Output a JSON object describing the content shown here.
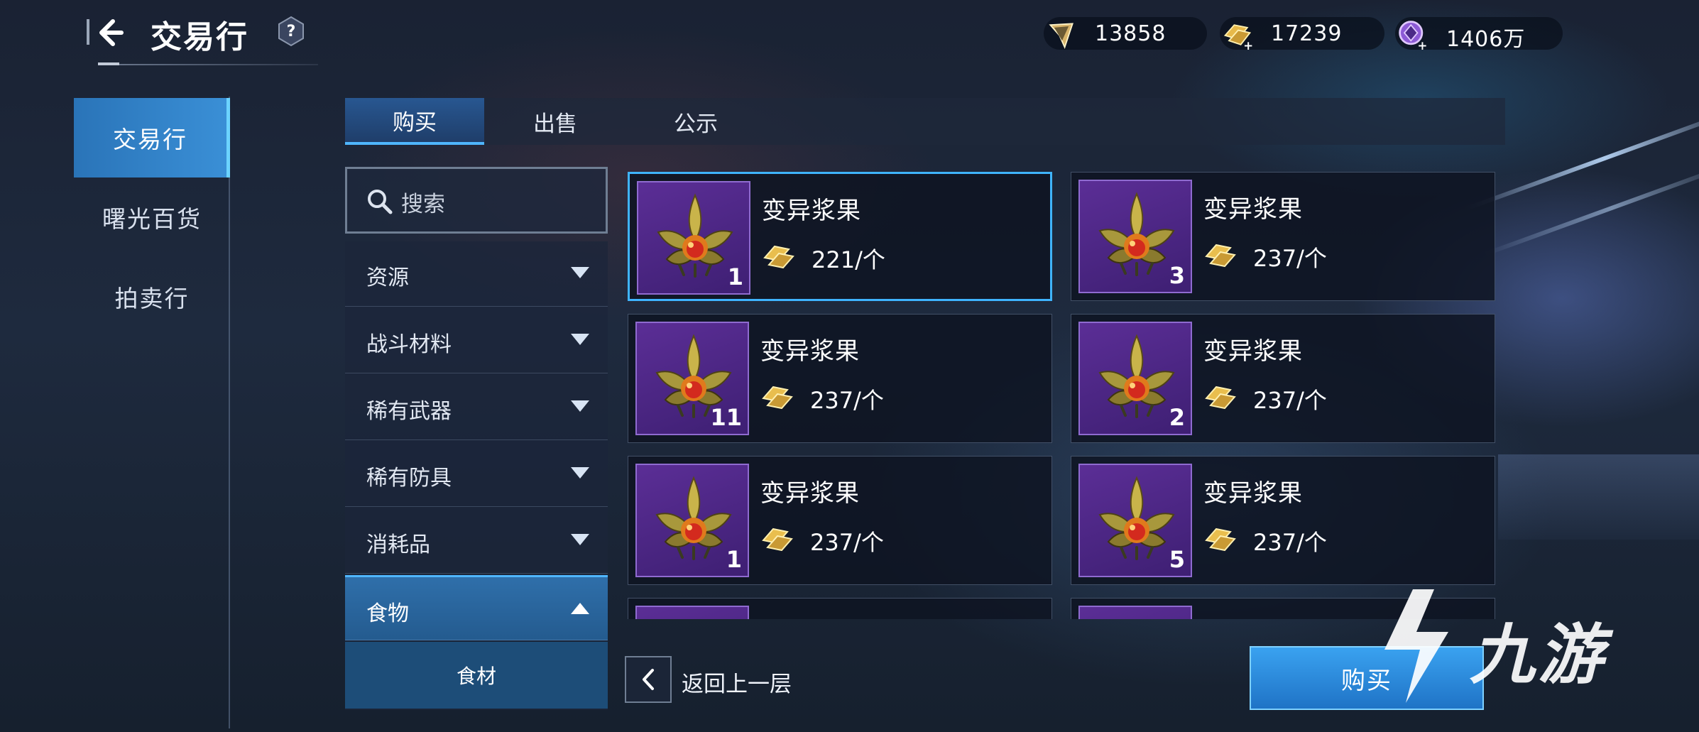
{
  "header": {
    "title": "交易行",
    "help_label": "?",
    "currencies": [
      {
        "icon": "crystal-shard-icon",
        "value": "13858"
      },
      {
        "icon": "gold-bar-plus-icon",
        "value": "17239"
      },
      {
        "icon": "purple-coin-plus-icon",
        "value": "1406万"
      }
    ]
  },
  "sidebar": {
    "items": [
      {
        "label": "交易行",
        "active": true
      },
      {
        "label": "曙光百货",
        "active": false
      },
      {
        "label": "拍卖行",
        "active": false
      }
    ]
  },
  "tabs": [
    {
      "label": "购买",
      "active": true
    },
    {
      "label": "出售",
      "active": false
    },
    {
      "label": "公示",
      "active": false
    }
  ],
  "search": {
    "placeholder": "搜索"
  },
  "categories": [
    {
      "label": "资源",
      "expanded": false
    },
    {
      "label": "战斗材料",
      "expanded": false
    },
    {
      "label": "稀有武器",
      "expanded": false
    },
    {
      "label": "稀有防具",
      "expanded": false
    },
    {
      "label": "消耗品",
      "expanded": false
    },
    {
      "label": "食物",
      "expanded": true
    }
  ],
  "subcategory": {
    "label": "食材"
  },
  "listings": [
    {
      "name": "变异浆果",
      "qty": "1",
      "price": "221/个",
      "selected": true
    },
    {
      "name": "变异浆果",
      "qty": "3",
      "price": "237/个",
      "selected": false
    },
    {
      "name": "变异浆果",
      "qty": "11",
      "price": "237/个",
      "selected": false
    },
    {
      "name": "变异浆果",
      "qty": "2",
      "price": "237/个",
      "selected": false
    },
    {
      "name": "变异浆果",
      "qty": "1",
      "price": "237/个",
      "selected": false
    },
    {
      "name": "变异浆果",
      "qty": "5",
      "price": "237/个",
      "selected": false
    }
  ],
  "footer": {
    "back_label": "返回上一层",
    "buy_label": "购买"
  },
  "watermark": {
    "text": "九游"
  },
  "colors": {
    "accent": "#3fb4ff",
    "item_bg": "#5b2e96",
    "buy_button": "#2a8ada"
  }
}
